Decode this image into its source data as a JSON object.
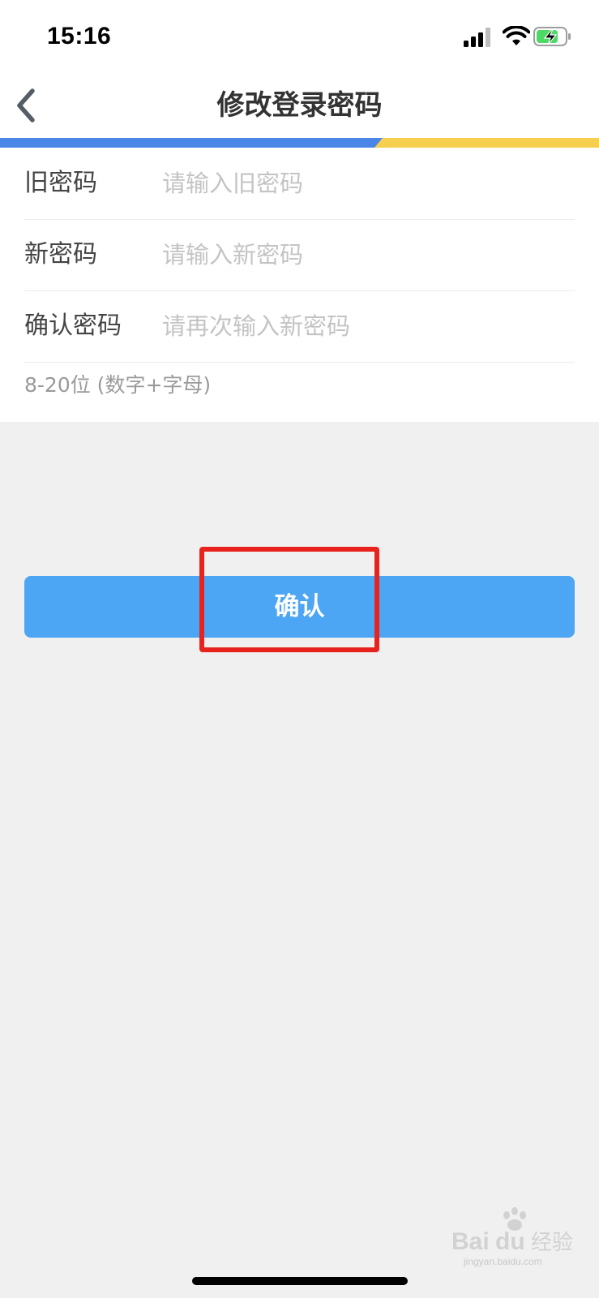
{
  "status_bar": {
    "time": "15:16",
    "icons": [
      "cellular-signal-icon",
      "wifi-icon",
      "battery-charging-icon"
    ]
  },
  "nav": {
    "back_icon": "chevron-left-icon",
    "title": "修改登录密码"
  },
  "accent_colors": {
    "primary_blue": "#4a86e8",
    "secondary_yellow": "#f5cf4d",
    "button_blue": "#4da6f3",
    "highlight_red": "#e8221c"
  },
  "form": {
    "rows": [
      {
        "label": "旧密码",
        "placeholder": "请输入旧密码",
        "value": ""
      },
      {
        "label": "新密码",
        "placeholder": "请输入新密码",
        "value": ""
      },
      {
        "label": "确认密码",
        "placeholder": "请再次输入新密码",
        "value": ""
      }
    ],
    "hint": "8-20位 (数字+字母)"
  },
  "confirm_button": {
    "label": "确认"
  },
  "watermark": {
    "text": "Bai",
    "suffix": "经验",
    "url_text": "jingyan.baidu.com"
  }
}
